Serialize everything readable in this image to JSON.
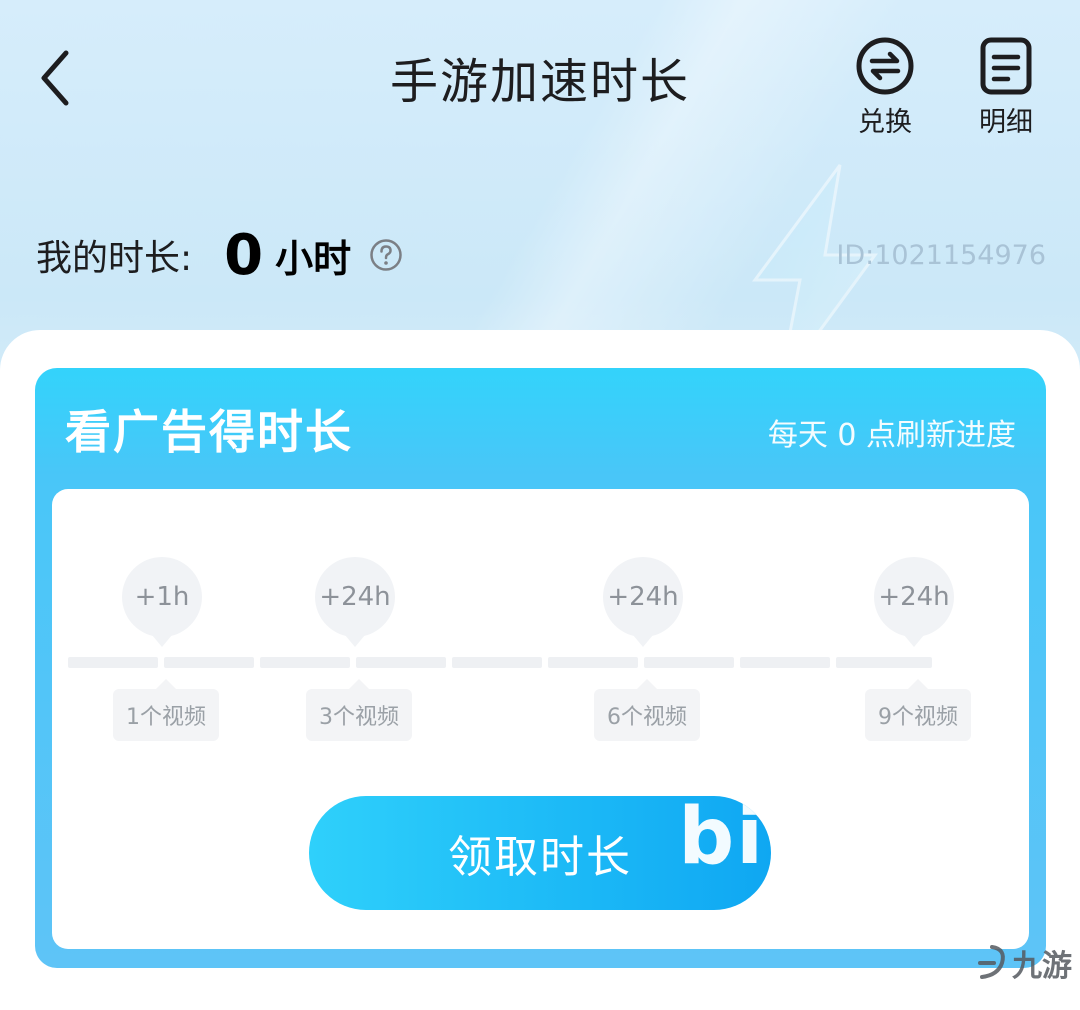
{
  "header": {
    "title": "手游加速时长",
    "exchange_label": "兑换",
    "detail_label": "明细"
  },
  "summary": {
    "label": "我的时长:",
    "value": "0",
    "unit": "小时",
    "user_id": "ID:1021154976"
  },
  "ad_card": {
    "title": "看广告得时长",
    "refresh_note": "每天 0 点刷新进度",
    "milestones": [
      {
        "reward": "+1h",
        "videos": "1个视频"
      },
      {
        "reward": "+24h",
        "videos": "3个视频"
      },
      {
        "reward": "+24h",
        "videos": "6个视频"
      },
      {
        "reward": "+24h",
        "videos": "9个视频"
      }
    ],
    "progress_completed": 0,
    "claim_label": "领取时长",
    "claim_overlay_text": "bi"
  },
  "watermark": {
    "text": "九游"
  },
  "colors": {
    "accent": "#1bb8f6",
    "card_top": "#33d3fb",
    "text_dark": "#1d1d1f"
  }
}
